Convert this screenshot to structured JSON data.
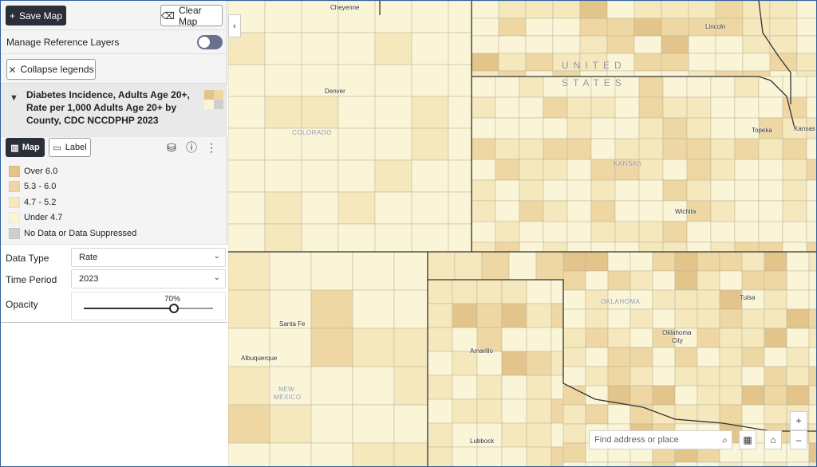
{
  "panel": {
    "save_map": "Save Map",
    "clear_map": "Clear Map",
    "manage_reference_layers": "Manage Reference Layers",
    "collapse_legends": "Collapse legends",
    "layer_title_line1": "Diabetes Incidence, Adults Age 20+,",
    "layer_title_line2": "Rate per 1,000 Adults Age 20+ by",
    "layer_title_line3": "County, CDC NCCDPHP 2023",
    "map_tab": "Map",
    "label_tab": "Label"
  },
  "legend": [
    {
      "label": "Over 6.0",
      "color": "#e3c48a"
    },
    {
      "label": "5.3 - 6.0",
      "color": "#eed7a3"
    },
    {
      "label": "4.7 - 5.2",
      "color": "#f6e8bd"
    },
    {
      "label": "Under 4.7",
      "color": "#fbf5d8"
    },
    {
      "label": "No Data or Data Suppressed",
      "color": "#cfcfcf"
    }
  ],
  "controls": {
    "data_type_label": "Data Type",
    "data_type_value": "Rate",
    "time_period_label": "Time Period",
    "time_period_value": "2023",
    "opacity_label": "Opacity",
    "opacity_value": "70%",
    "opacity_fraction": 0.7
  },
  "map": {
    "country_line1": "UNITED",
    "country_line2": "STATES",
    "states": [
      "COLORADO",
      "KANSAS",
      "OKLAHOMA",
      "NEW",
      "MEXICO"
    ],
    "cities": [
      "Cheyenne",
      "Lincoln",
      "Denver",
      "Topeka",
      "Kansas",
      "Wichita",
      "Tulsa",
      "Santa Fe",
      "Oklahoma",
      "City",
      "Albuquerque",
      "Amarillo",
      "Lubbock"
    ],
    "search_placeholder": "Find address or place",
    "zoom_in": "+",
    "zoom_out": "–"
  },
  "colors": {
    "over_6": "#e3c48a",
    "c53_60": "#eed7a3",
    "c47_52": "#f6e8bd",
    "under_47": "#fbf5d8",
    "no_data": "#cfcfcf"
  }
}
